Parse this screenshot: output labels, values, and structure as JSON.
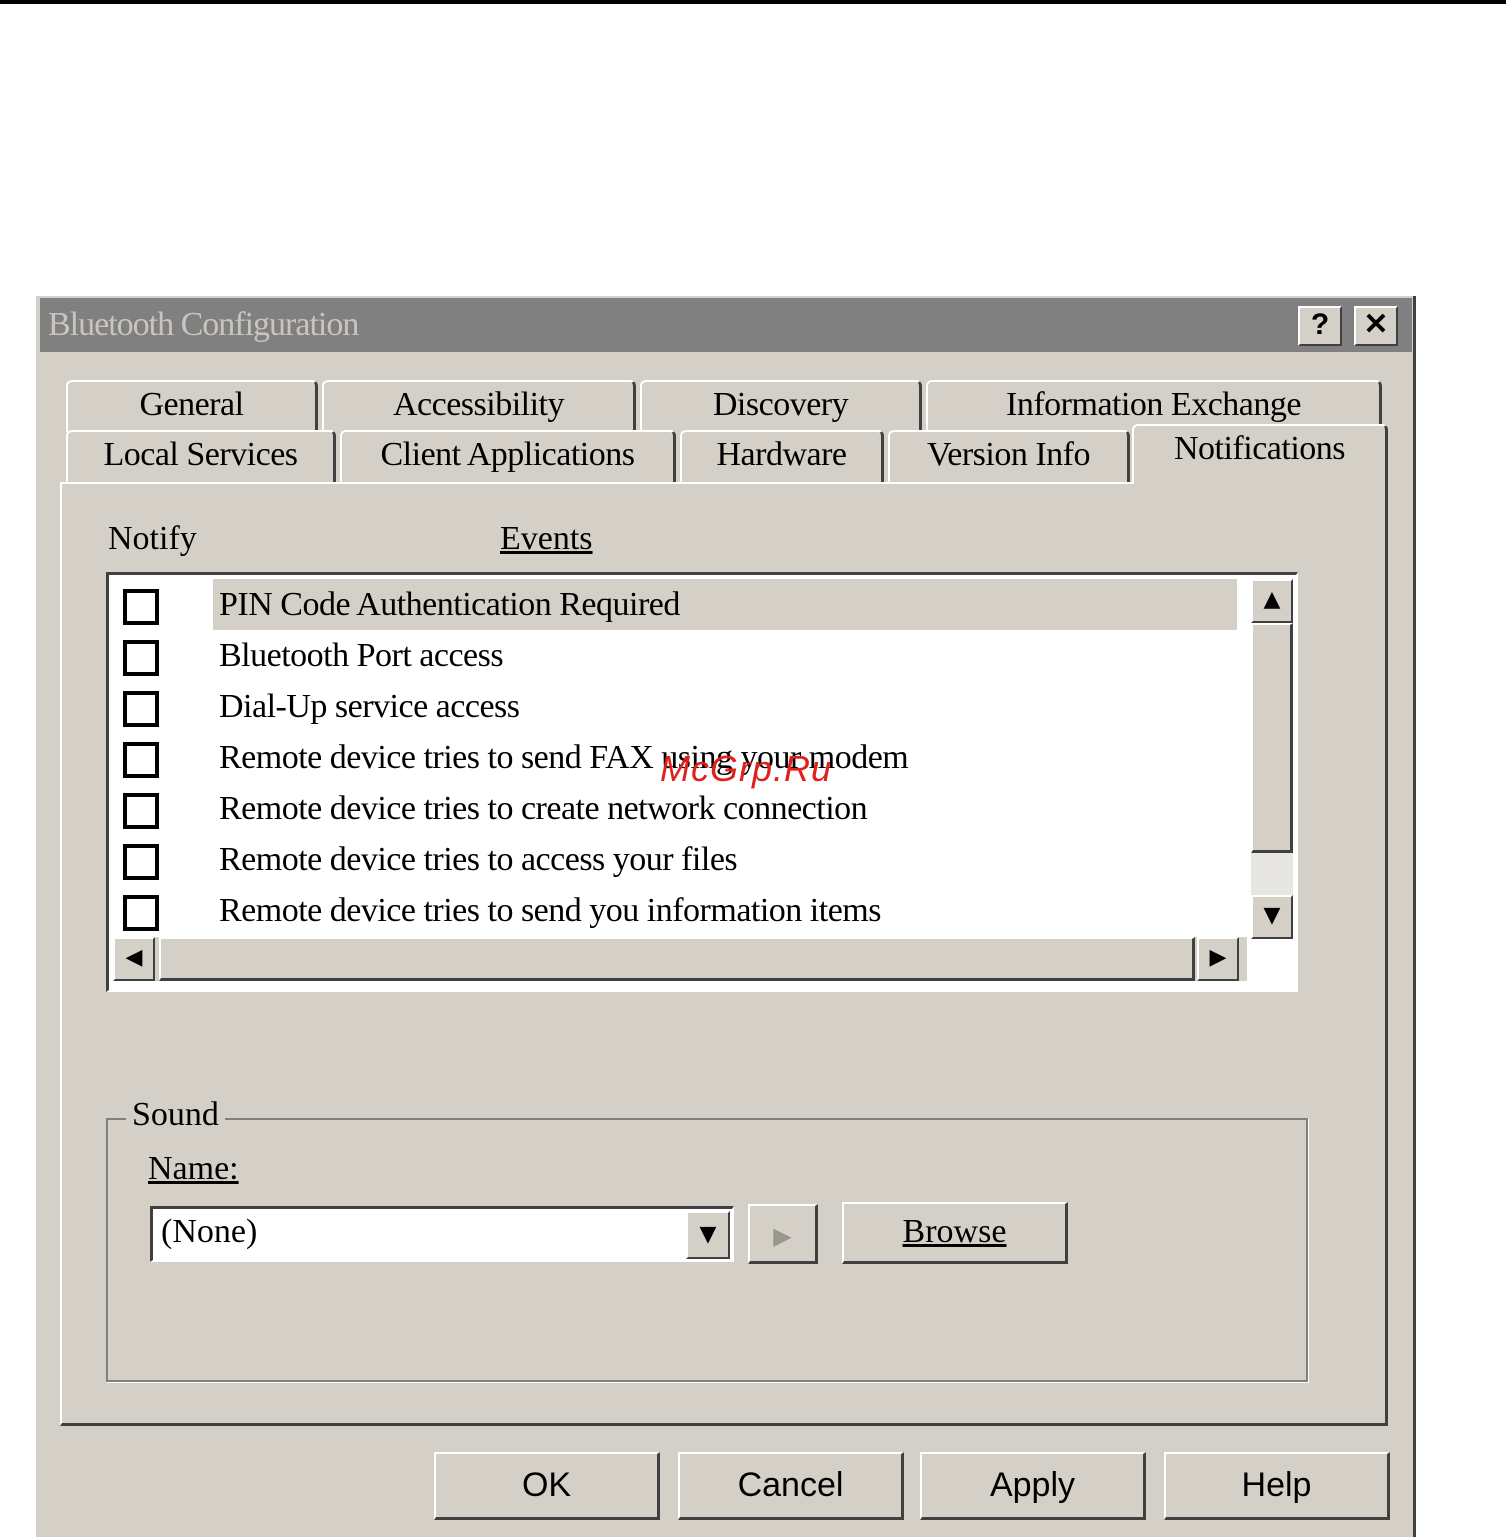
{
  "window": {
    "title": "Bluetooth Configuration",
    "help_label": "?",
    "close_label": "✕"
  },
  "tabs": {
    "row1": [
      "General",
      "Accessibility",
      "Discovery",
      "Information Exchange"
    ],
    "row2": [
      "Local Services",
      "Client Applications",
      "Hardware",
      "Version Info",
      "Notifications"
    ],
    "active": "Notifications"
  },
  "notifications": {
    "notify_header": "Notify",
    "events_header": "Events",
    "events": [
      {
        "label": "PIN Code Authentication Required",
        "checked": false,
        "selected": true
      },
      {
        "label": "Bluetooth Port access",
        "checked": false
      },
      {
        "label": "Dial-Up service access",
        "checked": false
      },
      {
        "label": "Remote device tries to send FAX using your modem",
        "checked": false
      },
      {
        "label": "Remote device tries to create network connection",
        "checked": false
      },
      {
        "label": "Remote device tries to access your files",
        "checked": false
      },
      {
        "label": "Remote device tries to send you information items",
        "checked": false
      }
    ]
  },
  "sound": {
    "group_label": "Sound",
    "name_label": "Name:",
    "name_value": "(None)",
    "play_icon": "play-icon",
    "browse_label": "Browse"
  },
  "footer": {
    "ok_label": "OK",
    "cancel_label": "Cancel",
    "apply_label": "Apply",
    "help_label": "Help"
  },
  "watermark": "McGrp.Ru"
}
